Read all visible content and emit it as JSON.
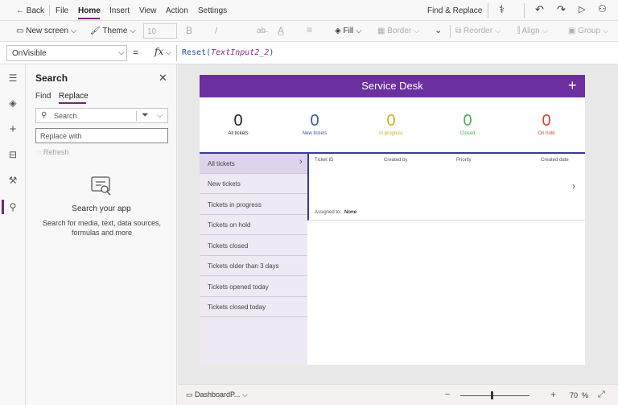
{
  "menu": {
    "back": "Back",
    "items": [
      "File",
      "Home",
      "Insert",
      "View",
      "Action",
      "Settings"
    ],
    "find_replace": "Find & Replace"
  },
  "toolbar": {
    "new_screen": "New screen",
    "theme": "Theme",
    "font_size": "10",
    "bold": "B",
    "italic": "/",
    "fill": "Fill",
    "border": "Border",
    "reorder": "Reorder",
    "align": "Align",
    "group": "Group"
  },
  "formula": {
    "property": "OnVisible",
    "equals": "=",
    "fx": "fx",
    "fn": "Reset",
    "arg": "TextInput2_2"
  },
  "panel": {
    "title": "Search",
    "tabs": [
      "Find",
      "Replace"
    ],
    "search_placeholder": "Search",
    "replace_placeholder": "Replace with",
    "refresh": "Refresh",
    "empty_title": "Search your app",
    "empty_desc": "Search for media, text, data sources, formulas and more"
  },
  "app": {
    "title": "Service Desk",
    "stats": [
      {
        "value": "0",
        "label": "All tickets",
        "color": "#222222"
      },
      {
        "value": "0",
        "label": "New tickets",
        "color": "#3a5a9c"
      },
      {
        "value": "0",
        "label": "In progress",
        "color": "#c7b51a"
      },
      {
        "value": "0",
        "label": "Closed",
        "color": "#4caf50"
      },
      {
        "value": "0",
        "label": "On hold",
        "color": "#d9442a"
      }
    ],
    "nav": [
      "All tickets",
      "New tickets",
      "Tickets in progress",
      "Tickets on hold",
      "Tickets closed",
      "Tickets older than 3 days",
      "Tickets opened today",
      "Tickets closed today"
    ],
    "columns": [
      "Ticket ID",
      "Created by",
      "Priority",
      "Created date"
    ],
    "assigned_label": "Assigned to:",
    "assigned_value": "None"
  },
  "status": {
    "screen": "DashboardP...",
    "zoom": "70",
    "zoom_unit": "%"
  },
  "colors": {
    "accent": "#742774",
    "header": "#6b2fa0"
  }
}
